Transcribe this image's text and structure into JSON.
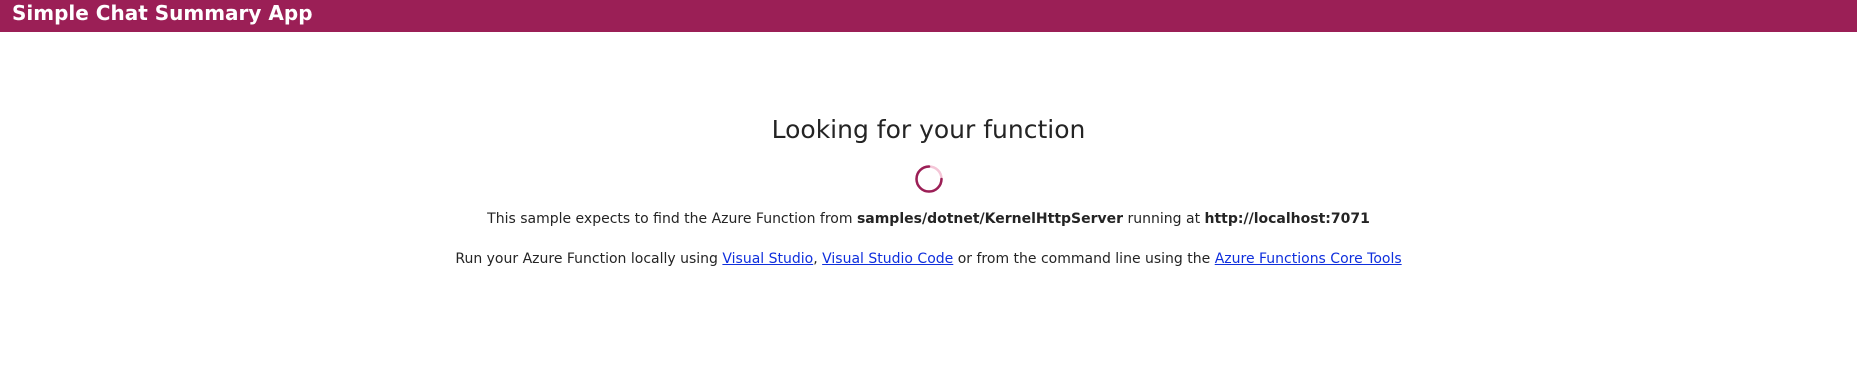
{
  "header": {
    "title": "Simple Chat Summary App",
    "background": "#9b1f56"
  },
  "main": {
    "heading": "Looking for your function",
    "spinner": {
      "icon": "loading-spinner-icon",
      "track_color": "#f4c6d7",
      "arc_color": "#9b1f56"
    },
    "line1": {
      "prefix": "This sample expects to find the Azure Function from ",
      "path": "samples/dotnet/KernelHttpServer",
      "middle": " running at ",
      "url": "http://localhost:7071"
    },
    "line2": {
      "prefix": "Run your Azure Function locally using ",
      "link1": "Visual Studio",
      "sep1": ", ",
      "link2": "Visual Studio Code",
      "middle": " or from the command line using the ",
      "link3": "Azure Functions Core Tools"
    }
  }
}
